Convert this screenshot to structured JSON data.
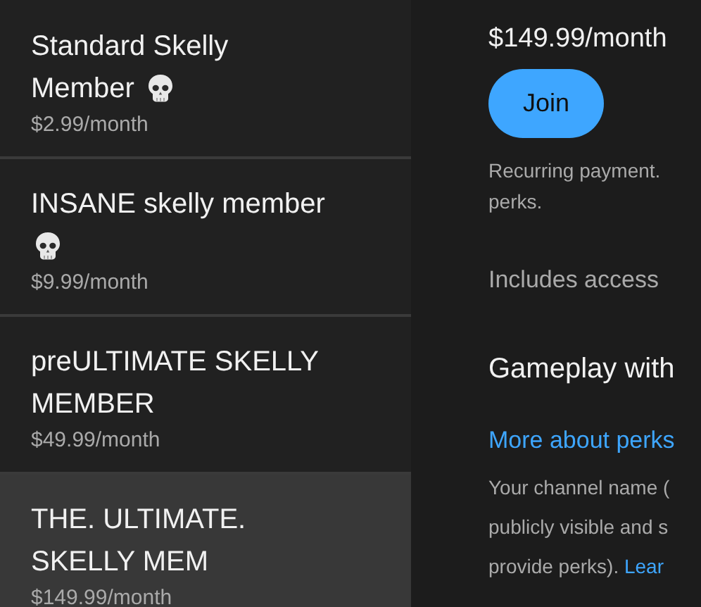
{
  "tiers": [
    {
      "title_lines": [
        "Standard Skelly",
        "Member"
      ],
      "skull": true,
      "price": "$2.99/month",
      "selected": false
    },
    {
      "title_lines": [
        "INSANE skelly member"
      ],
      "skull": true,
      "price": "$9.99/month",
      "selected": false
    },
    {
      "title_lines": [
        "preULTIMATE SKELLY",
        "MEMBER"
      ],
      "skull": false,
      "price": "$49.99/month",
      "selected": false
    },
    {
      "title_lines": [
        "THE. ULTIMATE.",
        "SKELLY MEM"
      ],
      "skull": false,
      "price": "$149.99/month",
      "selected": true
    }
  ],
  "detail": {
    "price": "$149.99/month",
    "join_button": "Join",
    "payment_note_lines": [
      "Recurring payment.",
      "perks."
    ],
    "includes": "Includes access",
    "perk": "Gameplay with",
    "more_link": "More about perks",
    "notice_lines": [
      "Your channel name (",
      "publicly visible and s",
      "provide perks)."
    ],
    "notice_link": "Lear"
  }
}
